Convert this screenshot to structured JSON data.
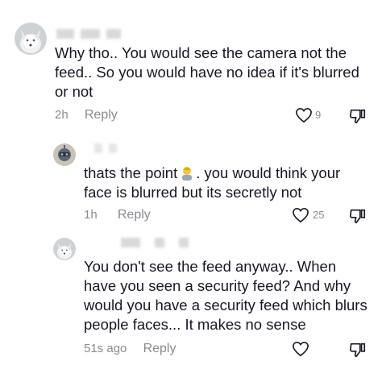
{
  "comments": [
    {
      "text_lines": [
        "Why tho.. You would see the camera not the",
        "feed.. So you would have no idea if it's blurred",
        "or not"
      ],
      "time": "2h",
      "reply_label": "Reply",
      "like_count": "9",
      "avatar_icon": "fox-avatar-icon"
    },
    {
      "text_line1_a": "thats the point",
      "text_line1_b": ". you would think your",
      "text_line2": "face is blurred but its secretly not",
      "emoji_icon": "person-emoji-icon",
      "time": "1h",
      "reply_label": "Reply",
      "like_count": "25",
      "avatar_icon": "robot-avatar-icon"
    },
    {
      "text_lines": [
        "You don't see the feed anyway.. When",
        "have you seen a security feed? And why",
        "would you have a security feed which blurs",
        "people faces... It makes no sense"
      ],
      "time": "51s ago",
      "reply_label": "Reply",
      "like_count": "",
      "avatar_icon": "fox-avatar-icon"
    }
  ],
  "colors": {
    "text": "#161823",
    "meta": "#8a8b91"
  }
}
